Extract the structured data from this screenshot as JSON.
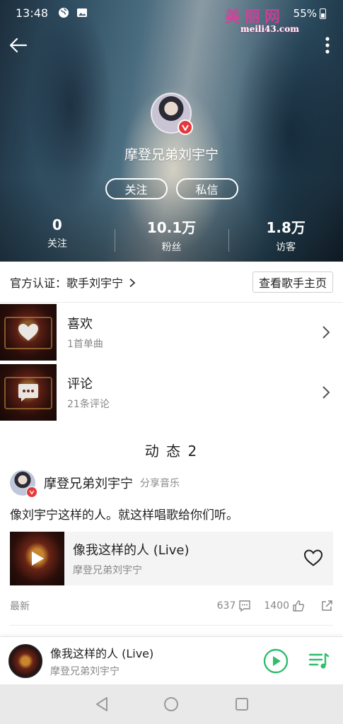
{
  "status_bar": {
    "time": "13:48",
    "battery": "55%",
    "icons": [
      "globe-icon",
      "image-icon",
      "battery-icon"
    ]
  },
  "watermark": {
    "logo_text": "美丽网",
    "url": "meili43.com"
  },
  "header": {
    "back_icon": "back-arrow-icon",
    "more_icon": "more-vertical-icon"
  },
  "profile": {
    "name": "摩登兄弟刘宇宁",
    "verified": true,
    "follow_label": "关注",
    "message_label": "私信",
    "stats": [
      {
        "value": "0",
        "label": "关注"
      },
      {
        "value": "10.1万",
        "label": "粉丝"
      },
      {
        "value": "1.8万",
        "label": "访客"
      }
    ]
  },
  "certification": {
    "text": "官方认证：歌手刘宇宁",
    "button_label": "查看歌手主页"
  },
  "menu": [
    {
      "title": "喜欢",
      "subtitle": "1首单曲",
      "icon": "heart-icon"
    },
    {
      "title": "评论",
      "subtitle": "21条评论",
      "icon": "comment-icon"
    }
  ],
  "feed": {
    "title": "动 态  2",
    "post": {
      "author": "摩登兄弟刘宇宁",
      "action": "分享音乐",
      "text": "像刘宇宁这样的人。就这样唱歌给你们听。",
      "song_title": "像我这样的人 (Live)",
      "song_artist": "摩登兄弟刘宇宁",
      "tag": "最新",
      "comments": "637",
      "likes": "1400"
    }
  },
  "player": {
    "title": "像我这样的人 (Live)",
    "artist": "摩登兄弟刘宇宁"
  },
  "colors": {
    "accent_green": "#2fbe6c",
    "verified_red": "#e4393c",
    "secondary_text": "#888888"
  }
}
